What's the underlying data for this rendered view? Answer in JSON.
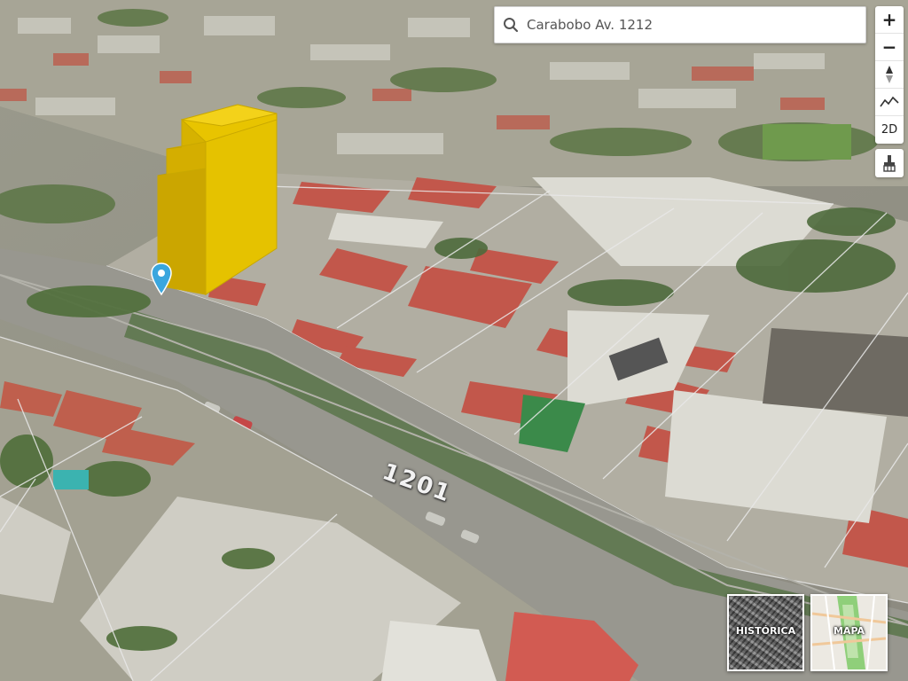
{
  "search": {
    "value": "Carabobo Av. 1212",
    "placeholder": ""
  },
  "map": {
    "street_number_label": "1201"
  },
  "controls": {
    "zoom_in": "+",
    "zoom_out": "−",
    "mode_2d": "2D"
  },
  "layers": {
    "historica": "HISTÓRICA",
    "mapa": "MAPA"
  },
  "colors": {
    "building": "#e8c200",
    "marker": "#3aa6de"
  }
}
